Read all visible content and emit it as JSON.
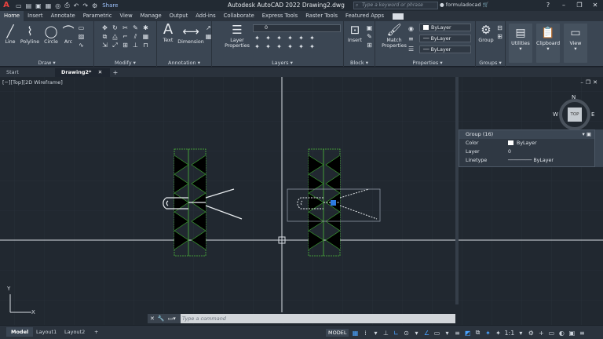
{
  "titlebar": {
    "logo": "A",
    "share": "Share",
    "title": "Autodesk AutoCAD 2022    Drawing2.dwg",
    "search_placeholder": "Type a keyword or phrase",
    "username": "formuladocad"
  },
  "tabs": [
    "Home",
    "Insert",
    "Annotate",
    "Parametric",
    "View",
    "Manage",
    "Output",
    "Add-ins",
    "Collaborate",
    "Express Tools",
    "Raster Tools",
    "Featured Apps"
  ],
  "ribbon": {
    "draw": {
      "title": "Draw",
      "line": "Line",
      "polyline": "Polyline",
      "circle": "Circle",
      "arc": "Arc"
    },
    "modify": {
      "title": "Modify"
    },
    "annotation": {
      "title": "Annotation",
      "text": "Text",
      "dimension": "Dimension"
    },
    "layers": {
      "title": "Layers",
      "layer_properties": "Layer Properties",
      "current_layer": "0"
    },
    "block": {
      "title": "Block",
      "insert": "Insert"
    },
    "properties": {
      "title": "Properties",
      "match": "Match Properties",
      "color": "ByLayer",
      "linetype": "ByLayer",
      "lineweight": "ByLayer"
    },
    "groups": {
      "title": "Groups",
      "group": "Group"
    },
    "utilities": "Utilities",
    "clipboard": "Clipboard",
    "view": "View"
  },
  "filetabs": {
    "start": "Start",
    "drawing": "Drawing2*"
  },
  "viewport": {
    "label": "[−][Top][2D Wireframe]"
  },
  "viewcube": {
    "n": "N",
    "w": "W",
    "e": "E",
    "top": "TOP"
  },
  "props_palette": {
    "header": "Group (16)",
    "rows": [
      {
        "key": "Color",
        "value": "ByLayer"
      },
      {
        "key": "Layer",
        "value": "0"
      },
      {
        "key": "Linetype",
        "value": "ByLayer"
      }
    ]
  },
  "ucs": {
    "x": "X",
    "y": "Y"
  },
  "command": {
    "placeholder": "Type a command"
  },
  "status": {
    "layouts": [
      "Model",
      "Layout1",
      "Layout2"
    ],
    "model": "MODEL",
    "scale": "1:1"
  }
}
